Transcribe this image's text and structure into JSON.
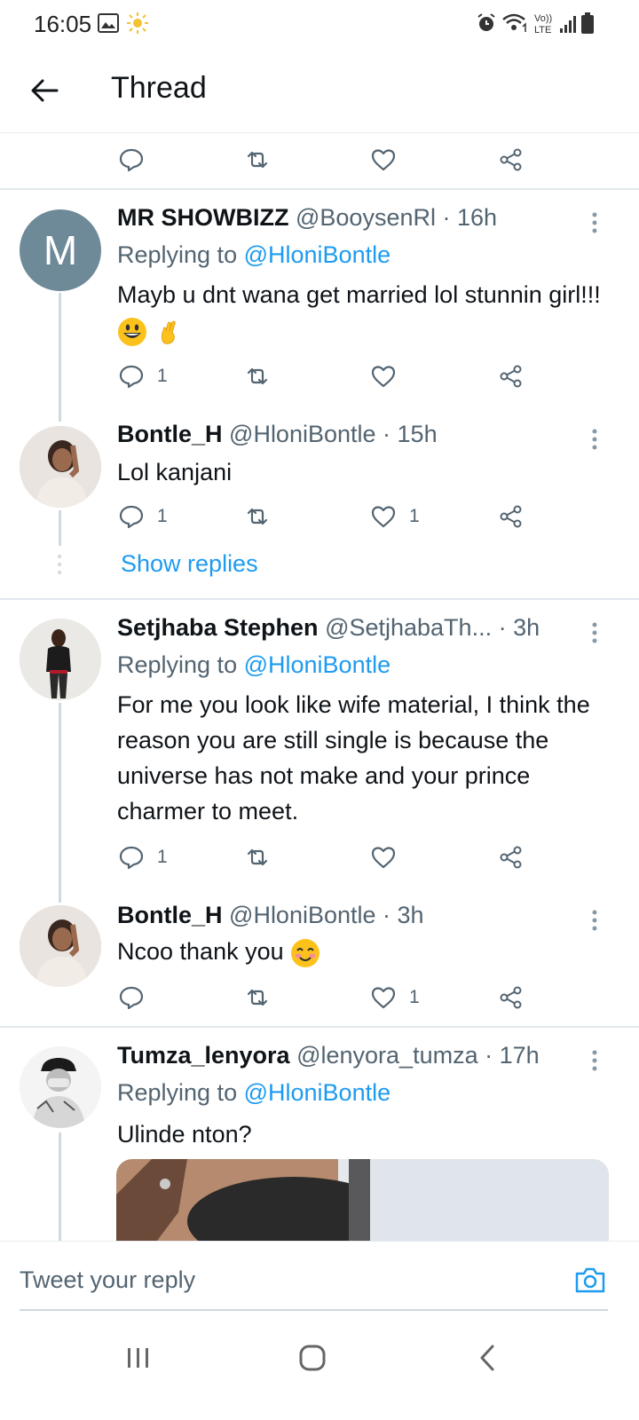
{
  "status_bar": {
    "time": "16:05"
  },
  "app_bar": {
    "title": "Thread"
  },
  "tweets": [
    {
      "name": "MR SHOWBIZZ",
      "handle": "@BooysenRl",
      "time": "· 16h",
      "replying_label": "Replying to",
      "replying_to": "@HloniBontle",
      "text": "Mayb u dnt wana get married lol stunnin girl!!!",
      "avatar_letter": "M",
      "reply_count": "1",
      "like_count": ""
    },
    {
      "name": "Bontle_H",
      "handle": "@HloniBontle",
      "time": "· 15h",
      "text": "Lol kanjani",
      "reply_count": "1",
      "like_count": "1"
    },
    {
      "name": "Setjhaba Stephen",
      "handle": "@SetjhabaTh...",
      "time": "· 3h",
      "replying_label": "Replying to",
      "replying_to": "@HloniBontle",
      "text": "For me you look like wife material, I think the reason you are still single is because the universe has not make and your prince charmer to meet.",
      "reply_count": "1",
      "like_count": ""
    },
    {
      "name": "Bontle_H",
      "handle": "@HloniBontle",
      "time": "· 3h",
      "text": "Ncoo thank you",
      "reply_count": "",
      "like_count": "1"
    },
    {
      "name": "Tumza_lenyora",
      "handle": "@lenyora_tumza",
      "time": "· 17h",
      "replying_label": "Replying to",
      "replying_to": "@HloniBontle",
      "text": "Ulinde nton?"
    }
  ],
  "show_replies": "Show replies",
  "compose": {
    "placeholder": "Tweet your reply"
  },
  "icons": {
    "reply": "reply-icon",
    "retweet": "retweet-icon",
    "like": "heart-icon",
    "share": "share-icon"
  },
  "colors": {
    "link": "#1d9bf0",
    "muted": "#536471",
    "text": "#0f1419"
  }
}
